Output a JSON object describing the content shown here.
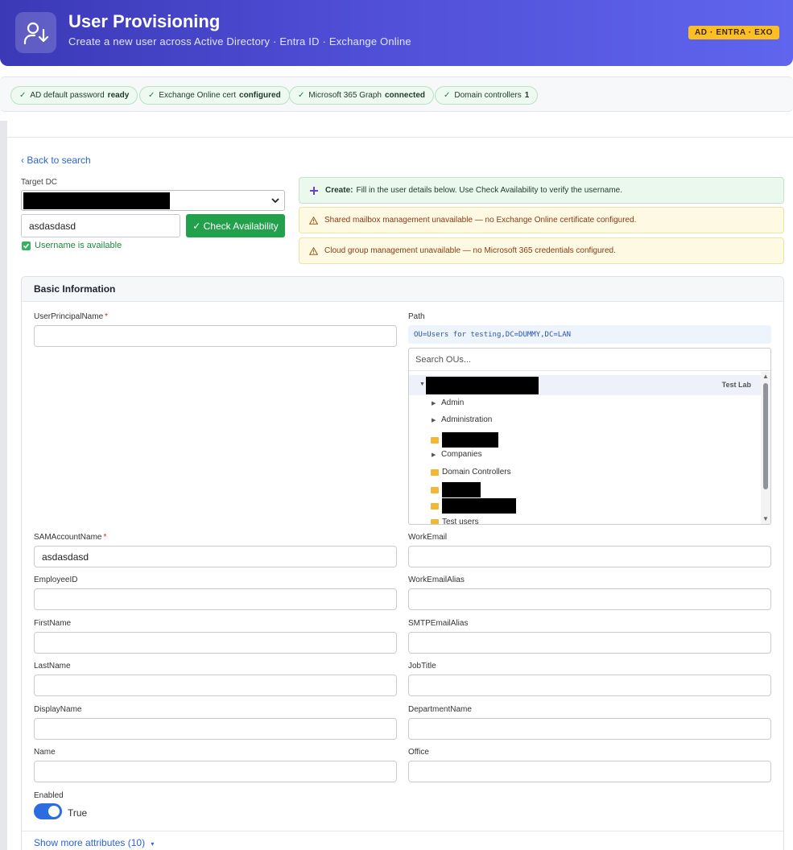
{
  "header": {
    "title": "User Provisioning",
    "subtitle": "Create a new user across Active Directory · Entra ID · Exchange Online",
    "badge": "AD · ENTRA · EXO"
  },
  "status": [
    {
      "label": "AD default password",
      "value": "ready"
    },
    {
      "label": "Exchange Online cert",
      "value": "configured"
    },
    {
      "label": "Microsoft 365 Graph",
      "value": "connected"
    },
    {
      "label": "Domain controllers",
      "value": "1"
    }
  ],
  "nav": {
    "back": "‹ Back to search"
  },
  "target_dc": {
    "label": "Target DC"
  },
  "username": {
    "value": "asdasdasd",
    "check_button": "✓ Check Availability",
    "availability": "Username is available"
  },
  "alerts": {
    "create_title": "Create:",
    "create_text": "Fill in the user details below. Use Check Availability to verify the username.",
    "mailbox": "Shared mailbox management unavailable — no Exchange Online certificate configured.",
    "cloud_group": "Cloud group management unavailable — no Microsoft 365 credentials configured."
  },
  "form": {
    "section_title": "Basic Information",
    "upn_label": "UserPrincipalName",
    "path_label": "Path",
    "path_value": "OU=Users for testing,DC=DUMMY,DC=LAN",
    "ou_search_placeholder": "Search OUs...",
    "ou_root_tag": "Test Lab",
    "ou_items": [
      "Admin",
      "Administration",
      "Companies",
      "Domain Controllers",
      "Test users"
    ],
    "sam_label": "SAMAccountName",
    "sam_value": "asdasdasd",
    "work_email_label": "WorkEmail",
    "employee_id_label": "EmployeeID",
    "work_email_alias_label": "WorkEmailAlias",
    "first_name_label": "FirstName",
    "smtp_alias_label": "SMTPEmailAlias",
    "last_name_label": "LastName",
    "job_title_label": "JobTitle",
    "display_name_label": "DisplayName",
    "department_label": "DepartmentName",
    "name_label": "Name",
    "office_label": "Office",
    "enabled_label": "Enabled",
    "enabled_value": "True",
    "enabled_on": true,
    "required_mark": "*",
    "more_attributes": "Show more attributes (10)",
    "more_caret": "▾"
  },
  "colors": {
    "header_start": "#3b39b6",
    "header_end": "#6065ee",
    "badge": "#fbbf24",
    "primary_button": "#22a04b",
    "link": "#2b63d9",
    "toggle": "#2c6be0"
  }
}
